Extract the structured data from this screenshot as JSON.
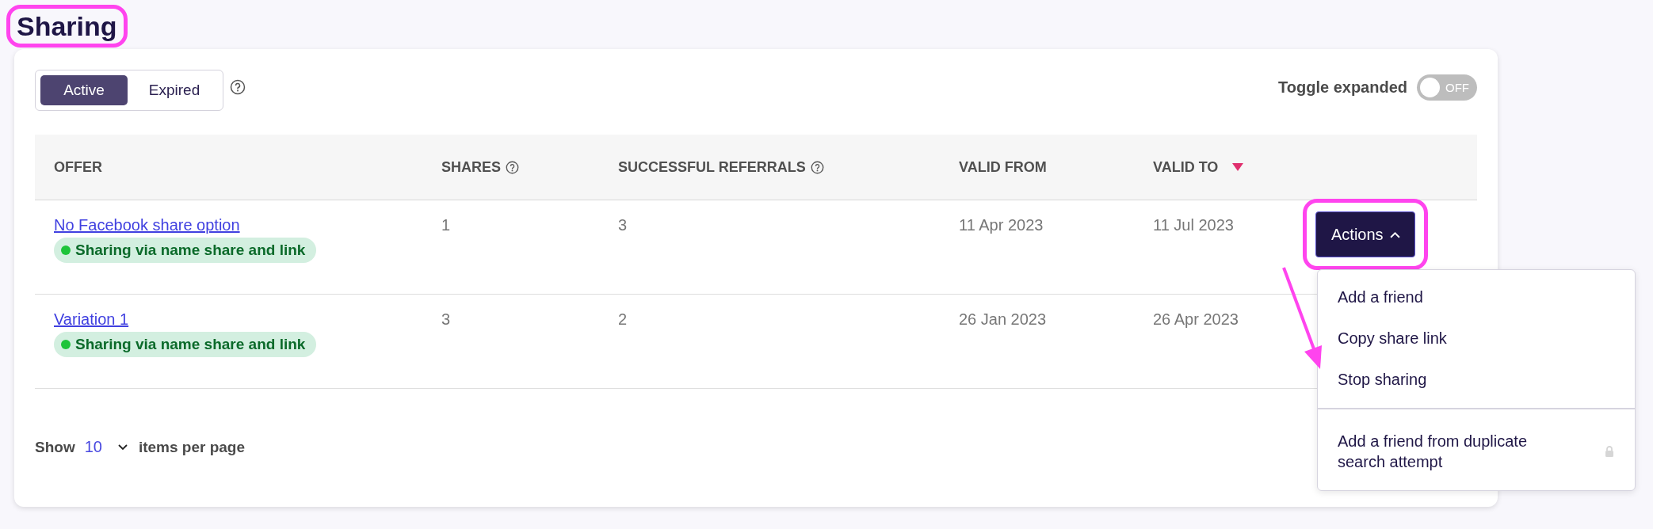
{
  "title": "Sharing",
  "filter_tabs": [
    {
      "label": "Active",
      "selected": true
    },
    {
      "label": "Expired",
      "selected": false
    }
  ],
  "toggle": {
    "label": "Toggle expanded",
    "on": false,
    "state_text": "OFF"
  },
  "table": {
    "columns": [
      {
        "label": "OFFER",
        "help": false,
        "sorted": false
      },
      {
        "label": "SHARES",
        "help": true,
        "sorted": false
      },
      {
        "label": "SUCCESSFUL REFERRALS",
        "help": true,
        "sorted": false
      },
      {
        "label": "VALID FROM",
        "help": false,
        "sorted": false
      },
      {
        "label": "VALID TO",
        "help": false,
        "sorted": true
      }
    ],
    "rows": [
      {
        "offer": "No Facebook share option",
        "status": "Sharing via name share and link",
        "shares": "1",
        "referrals": "3",
        "valid_from": "11 Apr 2023",
        "valid_to": "11 Jul 2023",
        "actions": {
          "label": "Actions",
          "expanded": true
        }
      },
      {
        "offer": "Variation 1",
        "status": "Sharing via name share and link",
        "shares": "3",
        "referrals": "2",
        "valid_from": "26 Jan 2023",
        "valid_to": "26 Apr 2023"
      }
    ]
  },
  "actions_menu": {
    "sections": [
      [
        {
          "label": "Add a friend",
          "locked": false
        },
        {
          "label": "Copy share link",
          "locked": false
        },
        {
          "label": "Stop sharing",
          "locked": false
        }
      ],
      [
        {
          "label": "Add a friend from duplicate search attempt",
          "locked": true
        }
      ]
    ]
  },
  "pagination": {
    "show_label": "Show",
    "page_size": "10",
    "suffix": "items per page"
  }
}
